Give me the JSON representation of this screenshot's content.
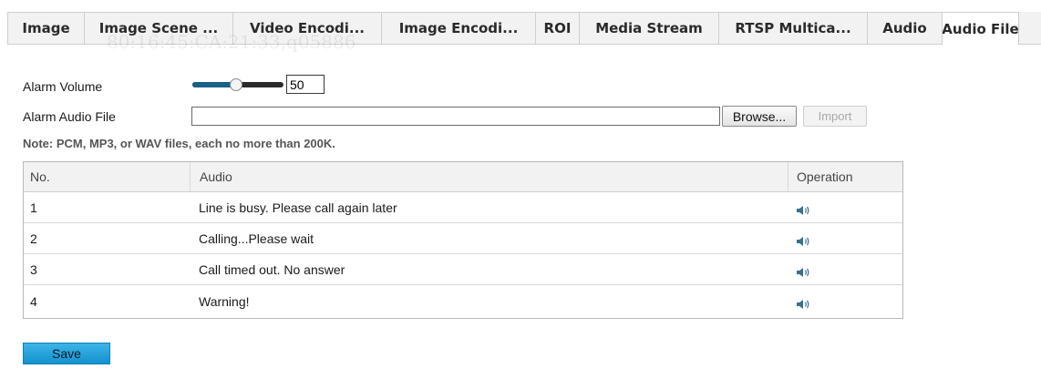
{
  "tabs": [
    {
      "label": "Image"
    },
    {
      "label": "Image Scene ..."
    },
    {
      "label": "Video Encodi..."
    },
    {
      "label": "Image Encodi..."
    },
    {
      "label": "ROI"
    },
    {
      "label": "Media Stream"
    },
    {
      "label": "RTSP Multica..."
    },
    {
      "label": "Audio"
    },
    {
      "label": "Audio File"
    }
  ],
  "active_tab": "Audio File",
  "watermark": "80:16:45:CA:21:33,q05886",
  "volume": {
    "label": "Alarm Volume",
    "value": "50"
  },
  "audio_file": {
    "label": "Alarm Audio File",
    "value": "",
    "browse_label": "Browse...",
    "import_label": "Import"
  },
  "note": "Note: PCM, MP3, or WAV files, each no more than 200K.",
  "table": {
    "headers": {
      "no": "No.",
      "audio": "Audio",
      "operation": "Operation"
    },
    "rows": [
      {
        "no": "1",
        "audio": "Line is busy. Please call again later",
        "operation_icon": "speaker-icon"
      },
      {
        "no": "2",
        "audio": "Calling...Please wait",
        "operation_icon": "speaker-icon"
      },
      {
        "no": "3",
        "audio": "Call timed out. No answer",
        "operation_icon": "speaker-icon"
      },
      {
        "no": "4",
        "audio": "Warning!",
        "operation_icon": "speaker-icon"
      }
    ]
  },
  "save_label": "Save",
  "colors": {
    "accent": "#1a5f86",
    "save_button": "#1492cf"
  }
}
